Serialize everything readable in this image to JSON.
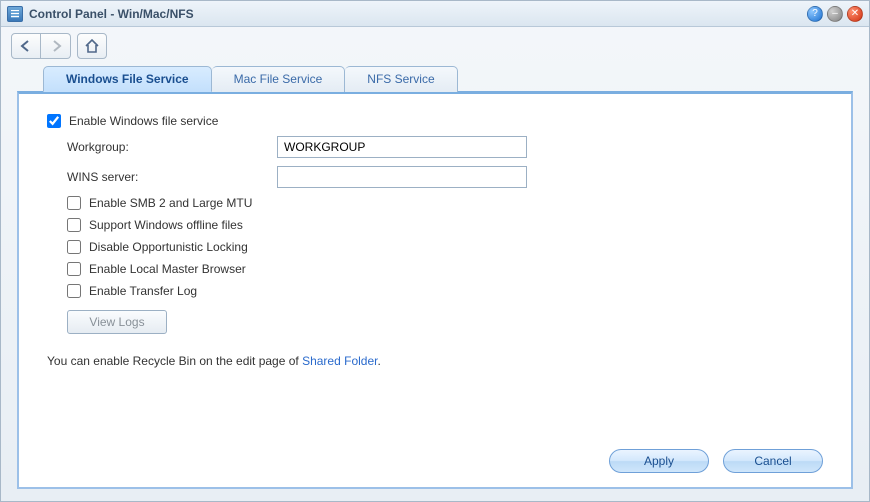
{
  "window": {
    "title": "Control Panel - Win/Mac/NFS"
  },
  "tabs": [
    {
      "label": "Windows File Service",
      "active": true
    },
    {
      "label": "Mac File Service",
      "active": false
    },
    {
      "label": "NFS Service",
      "active": false
    }
  ],
  "form": {
    "enable_windows": {
      "label": "Enable Windows file service",
      "checked": true
    },
    "workgroup": {
      "label": "Workgroup:",
      "value": "WORKGROUP"
    },
    "wins": {
      "label": "WINS server:",
      "value": ""
    },
    "smb2": {
      "label": "Enable SMB 2 and Large MTU",
      "checked": false
    },
    "offline": {
      "label": "Support Windows offline files",
      "checked": false
    },
    "oplock": {
      "label": "Disable Opportunistic Locking",
      "checked": false
    },
    "lmb": {
      "label": "Enable Local Master Browser",
      "checked": false
    },
    "xferlog": {
      "label": "Enable Transfer Log",
      "checked": false
    },
    "view_logs": "View Logs",
    "note_prefix": "You can enable Recycle Bin on the edit page of ",
    "note_link": "Shared Folder",
    "note_suffix": "."
  },
  "buttons": {
    "apply": "Apply",
    "cancel": "Cancel"
  }
}
